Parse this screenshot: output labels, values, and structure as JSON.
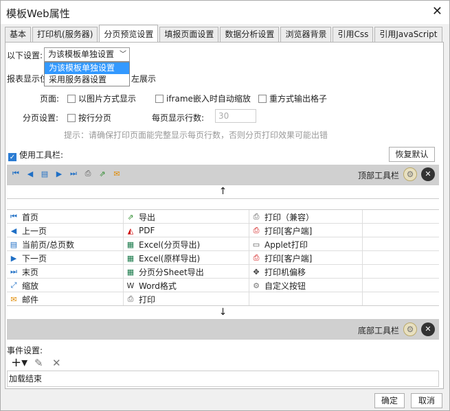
{
  "window": {
    "title": "模板Web属性"
  },
  "tabs": [
    "基本",
    "打印机(服务器)",
    "分页预览设置",
    "填报页面设置",
    "数据分析设置",
    "浏览器背景",
    "引用Css",
    "引用JavaScript"
  ],
  "settings": {
    "label": "以下设置:",
    "selected": "为该模板单独设置",
    "options": [
      "为该模板单独设置",
      "采用服务器设置"
    ],
    "report_display_left": "报表显示位",
    "report_display_right": "左展示"
  },
  "page": {
    "label": "页面:",
    "opt1": "以图片方式显示",
    "opt2": "iframe嵌入时自动缩放",
    "opt3": "重方式输出格子"
  },
  "paging": {
    "label": "分页设置:",
    "opt": "按行分页",
    "rows_label": "每页显示行数:",
    "rows_value": "30",
    "hint": "提示：请确保打印页面能完整显示每页行数，否则分页打印效果可能出错"
  },
  "toolbar": {
    "use_label": "使用工具栏:",
    "restore": "恢复默认",
    "top_label": "顶部工具栏",
    "bottom_label": "底部工具栏"
  },
  "buttons_grid": [
    [
      "首页",
      "导出",
      "打印（兼容）",
      ""
    ],
    [
      "上一页",
      "PDF",
      "打印[客户端]",
      ""
    ],
    [
      "当前页/总页数",
      "Excel(分页导出)",
      "Applet打印",
      ""
    ],
    [
      "下一页",
      "Excel(原样导出)",
      "打印[客户端]",
      ""
    ],
    [
      "末页",
      "分页分Sheet导出",
      "打印机偏移",
      ""
    ],
    [
      "缩放",
      "Word格式",
      "自定义按钮",
      ""
    ],
    [
      "邮件",
      "打印",
      "",
      ""
    ]
  ],
  "events": {
    "label": "事件设置:",
    "item": "加载结束"
  },
  "dialog": {
    "ok": "确定",
    "cancel": "取消"
  }
}
